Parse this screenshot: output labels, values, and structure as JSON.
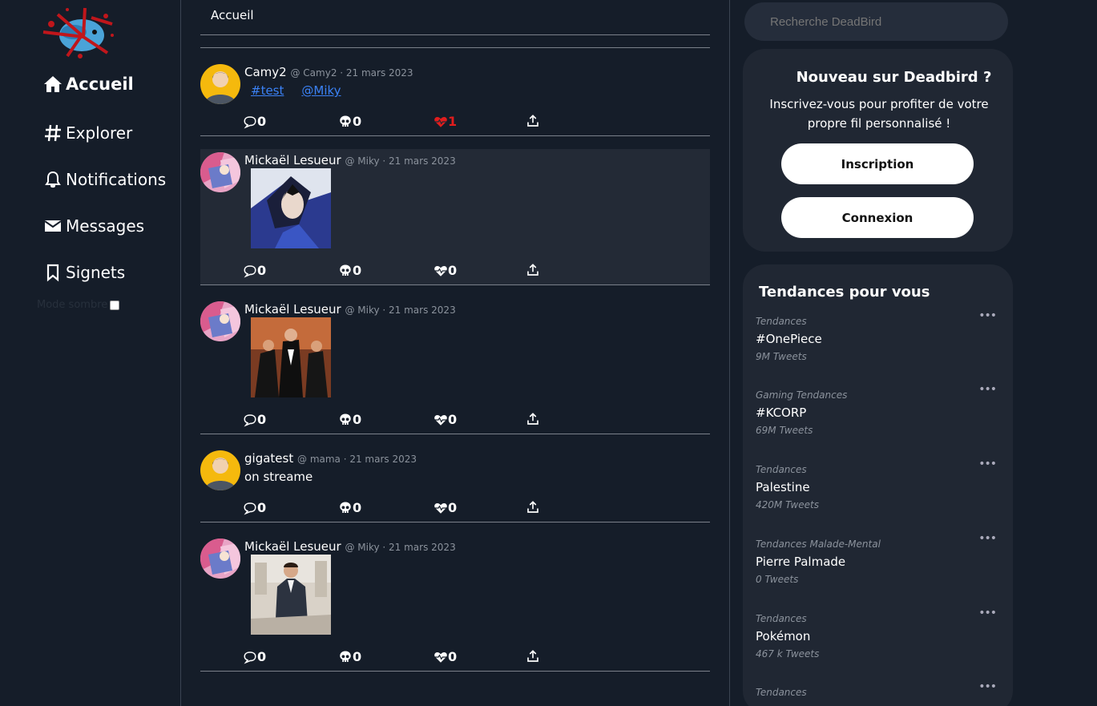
{
  "nav": {
    "items": [
      {
        "label": "Accueil",
        "icon": "home-icon"
      },
      {
        "label": "Explorer",
        "icon": "hash-icon"
      },
      {
        "label": "Notifications",
        "icon": "bell-icon"
      },
      {
        "label": "Messages",
        "icon": "envelope-icon"
      },
      {
        "label": "Signets",
        "icon": "bookmark-icon"
      }
    ],
    "dark_mode_label": "Mode sombre"
  },
  "feed": {
    "title": "Accueil",
    "tweets": [
      {
        "name": "Camy2",
        "meta": "@ Camy2 · 21 mars 2023",
        "links": [
          "#test",
          "@Miky"
        ],
        "comments": "0",
        "dislikes": "0",
        "likes": "1",
        "liked": true
      },
      {
        "name": "Mickaël Lesueur",
        "meta": "@ Miky · 21 mars 2023",
        "comments": "0",
        "dislikes": "0",
        "likes": "0"
      },
      {
        "name": "Mickaël Lesueur",
        "meta": "@ Miky · 21 mars 2023",
        "comments": "0",
        "dislikes": "0",
        "likes": "0"
      },
      {
        "name": "gigatest",
        "meta": "@ mama · 21 mars 2023",
        "text": "on streame",
        "comments": "0",
        "dislikes": "0",
        "likes": "0"
      },
      {
        "name": "Mickaël Lesueur",
        "meta": "@ Miky · 21 mars 2023",
        "comments": "0",
        "dislikes": "0",
        "likes": "0"
      }
    ]
  },
  "search": {
    "placeholder": "Recherche DeadBird"
  },
  "signup": {
    "title": "Nouveau sur Deadbird ?",
    "text": "Inscrivez-vous pour profiter de votre propre fil personnalisé !",
    "register_label": "Inscription",
    "login_label": "Connexion"
  },
  "trends": {
    "title": "Tendances pour vous",
    "more": "•••",
    "items": [
      {
        "category": "Tendances",
        "name": "#OnePiece",
        "count": "9M Tweets"
      },
      {
        "category": "Gaming Tendances",
        "name": "#KCORP",
        "count": "69M Tweets"
      },
      {
        "category": "Tendances",
        "name": "Palestine",
        "count": "420M Tweets"
      },
      {
        "category": "Tendances Malade-Mental",
        "name": "Pierre Palmade",
        "count": "0 Tweets"
      },
      {
        "category": "Tendances",
        "name": "Pokémon",
        "count": "467 k Tweets"
      },
      {
        "category": "Tendances",
        "name": "",
        "count": ""
      }
    ]
  },
  "colors": {
    "background": "#151d29",
    "card": "#202733",
    "like": "#e11d1d",
    "link": "#3b82f6"
  }
}
